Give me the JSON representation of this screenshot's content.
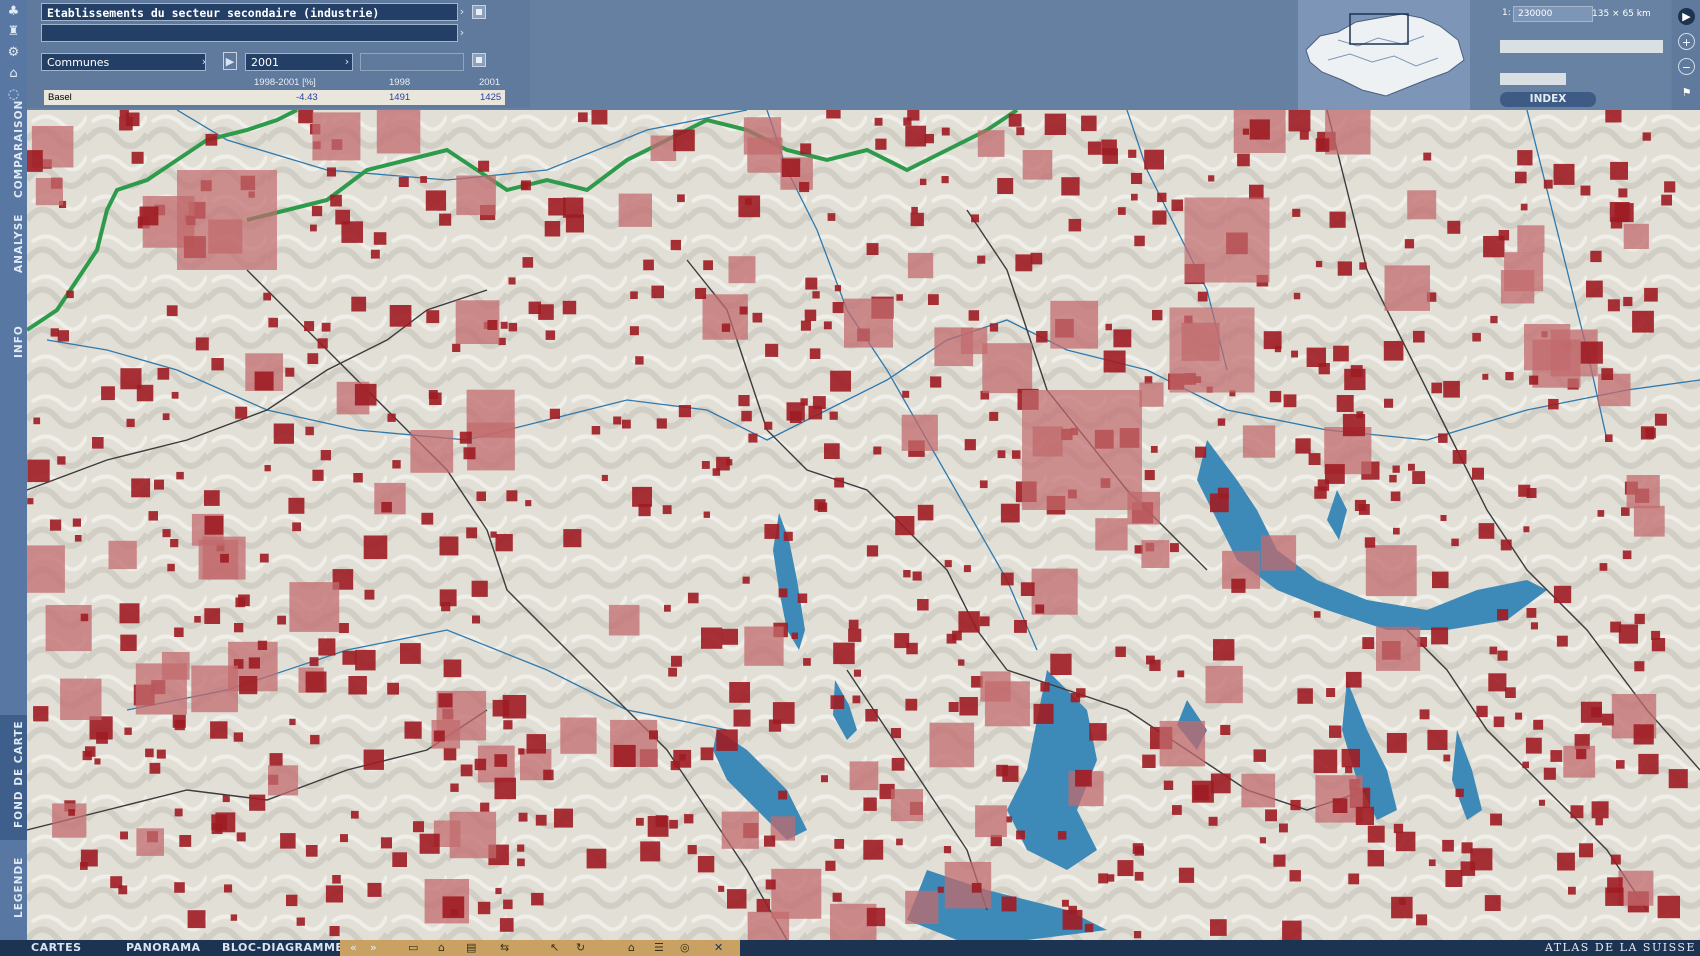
{
  "theme": "Etablissements du secteur secondaire (industrie)",
  "sub_theme": "",
  "level": "Communes",
  "year": "2001",
  "table": {
    "headers": [
      "1998-2001 [%]",
      "1998",
      "2001"
    ],
    "row": {
      "name": "Basel",
      "change": "-4.43",
      "y1998": "1491",
      "y2001": "1425"
    }
  },
  "scale": {
    "prefix": "1:",
    "value": "230000",
    "dimensions": "135 × 65 km"
  },
  "index_label": "INDEX",
  "left_tabs": [
    "COMPARAISON",
    "ANALYSE",
    "INFO",
    "FOND DE CARTE",
    "LEGENDE"
  ],
  "left_icons": [
    "tree-icon",
    "factory-icon",
    "gear-icon",
    "building-icon",
    "globe-icon"
  ],
  "right_icons": [
    "play-icon",
    "zoom-in-icon",
    "zoom-out-icon",
    "flag-icon"
  ],
  "bottom_tabs": [
    "CARTES",
    "PANORAMA",
    "BLOC-DIAGRAMME"
  ],
  "bottom_tool_icons": [
    "back-icon",
    "forward-icon",
    "page-icon",
    "lock-icon",
    "print-icon",
    "export-icon",
    "cursor-icon",
    "rotate-icon",
    "home-icon",
    "list-icon",
    "layers-icon",
    "close-icon"
  ],
  "brand": "ATLAS DE LA SUISSE",
  "colors": {
    "symbol": "#9e1c23",
    "symbol_light": "#c26b6e",
    "lake": "#3d89b8",
    "border": "#2e9b4c",
    "panel": "#6680a2"
  }
}
